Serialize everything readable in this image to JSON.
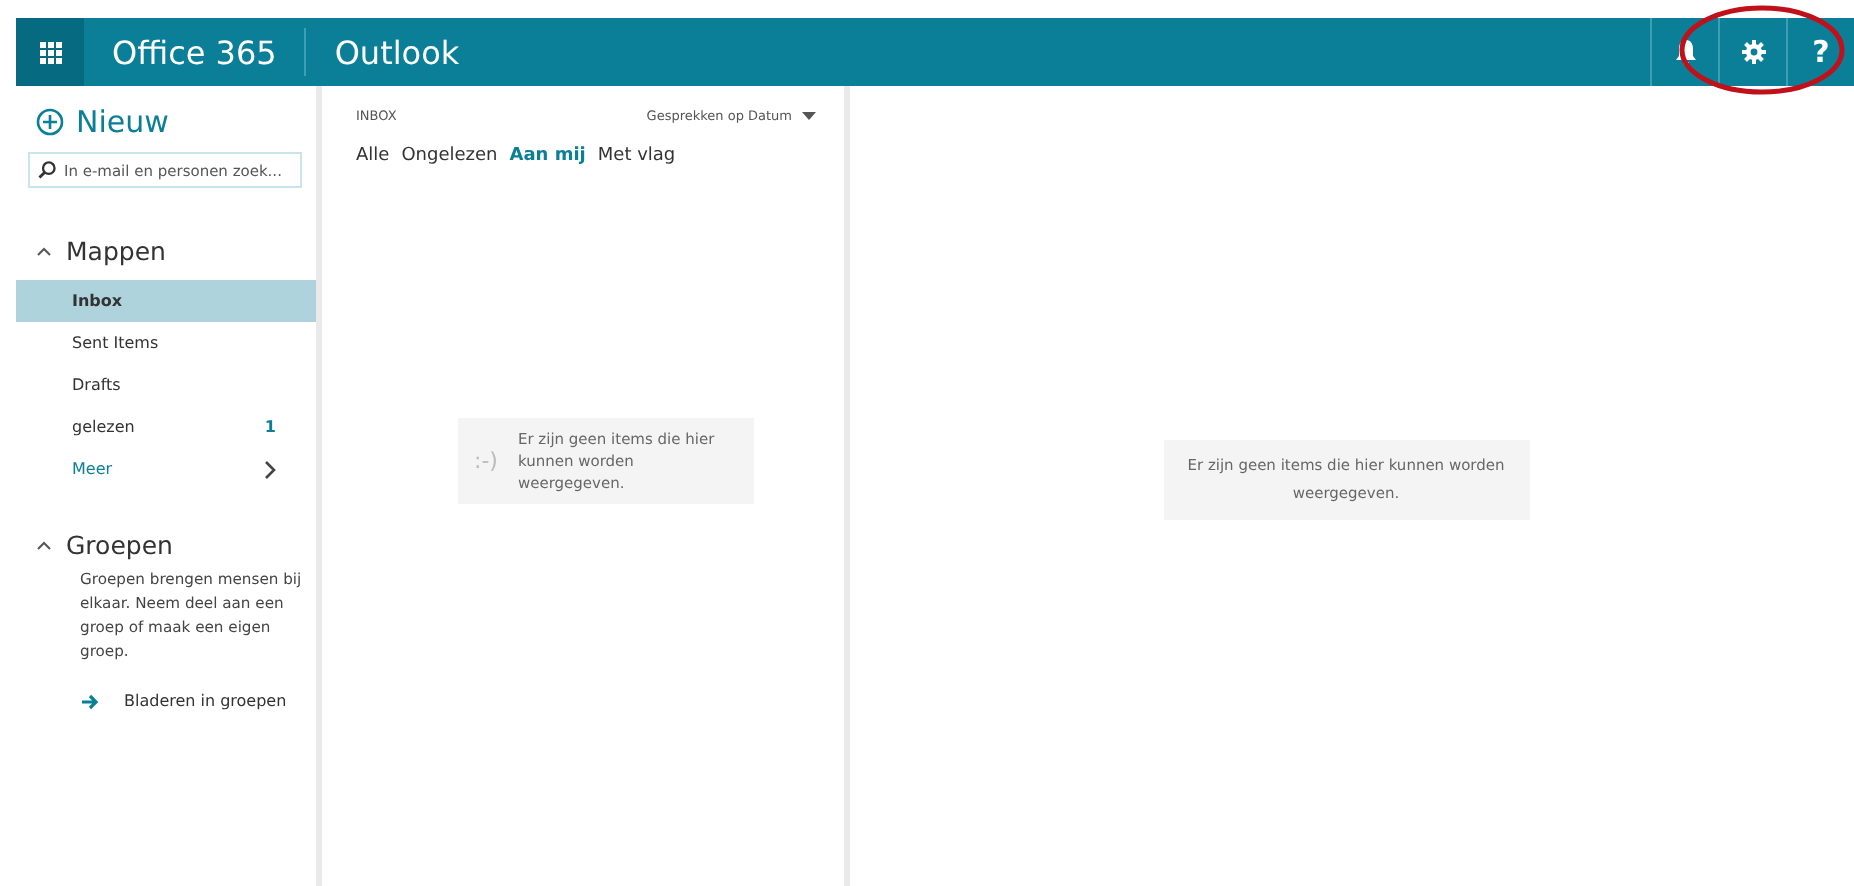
{
  "header": {
    "brand": "Office 365",
    "app": "Outlook",
    "actions": [
      {
        "kind": "bell",
        "highlighted": false
      },
      {
        "kind": "gear",
        "highlighted": true
      },
      {
        "kind": "help",
        "label": "?",
        "highlighted": false
      }
    ]
  },
  "annotation": {
    "kind": "ellipse",
    "color": "#c0101a"
  },
  "sidebar": {
    "new_button": "Nieuw",
    "search": {
      "placeholder": "In e-mail en personen zoek..."
    },
    "folders_heading": "Mappen",
    "folders_expanded": true,
    "folders": [
      {
        "label": "Inbox",
        "selected": true
      },
      {
        "label": "Sent Items",
        "selected": false
      },
      {
        "label": "Drafts",
        "selected": false
      },
      {
        "label": "gelezen",
        "selected": false,
        "count": "1"
      }
    ],
    "more": "Meer",
    "groups_heading": "Groepen",
    "groups_expanded": true,
    "groups_text": "Groepen brengen mensen bij elkaar. Neem deel aan een groep of maak een eigen groep.",
    "browse_groups": "Bladeren in groepen"
  },
  "message_list": {
    "folder": "INBOX",
    "sort": "Gesprekken op Datum",
    "filters": [
      {
        "label": "Alle",
        "selected": false
      },
      {
        "label": "Ongelezen",
        "selected": false
      },
      {
        "label": "Aan mij",
        "selected": true
      },
      {
        "label": "Met vlag",
        "selected": false
      }
    ],
    "empty": {
      "emoticon": ":-)",
      "text": "Er zijn geen items die hier kunnen worden weergegeven."
    }
  },
  "reading_pane": {
    "empty_text": "Er zijn geen items die hier kunnen worden weergegeven."
  }
}
